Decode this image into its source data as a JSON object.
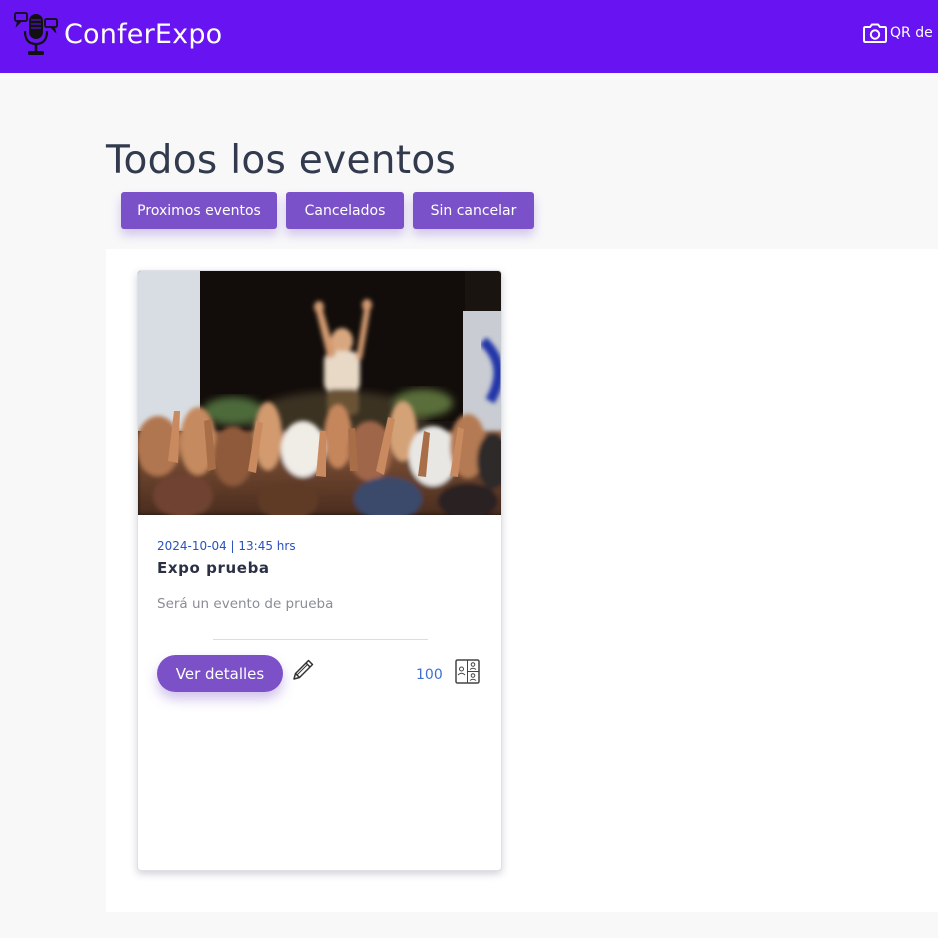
{
  "navbar": {
    "brand": "ConferExpo",
    "logo_icon": "microphone-logo-icon",
    "qr_icon": "camera-icon",
    "qr_label": "QR de"
  },
  "page": {
    "title": "Todos los eventos"
  },
  "filters": [
    {
      "label": "Proximos eventos"
    },
    {
      "label": "Cancelados"
    },
    {
      "label": "Sin cancelar"
    }
  ],
  "events": [
    {
      "datetime": "2024-10-04 | 13:45 hrs",
      "title": "Expo prueba",
      "description": "Será un evento de prueba",
      "details_label": "Ver detalles",
      "edit_icon": "pencil-icon",
      "capacity": "100",
      "capacity_icon": "attendees-icon"
    }
  ],
  "colors": {
    "navbar": "#6713f2",
    "button": "#7b51c9",
    "accent_text": "#2a52be",
    "title_text": "#323a4e"
  }
}
